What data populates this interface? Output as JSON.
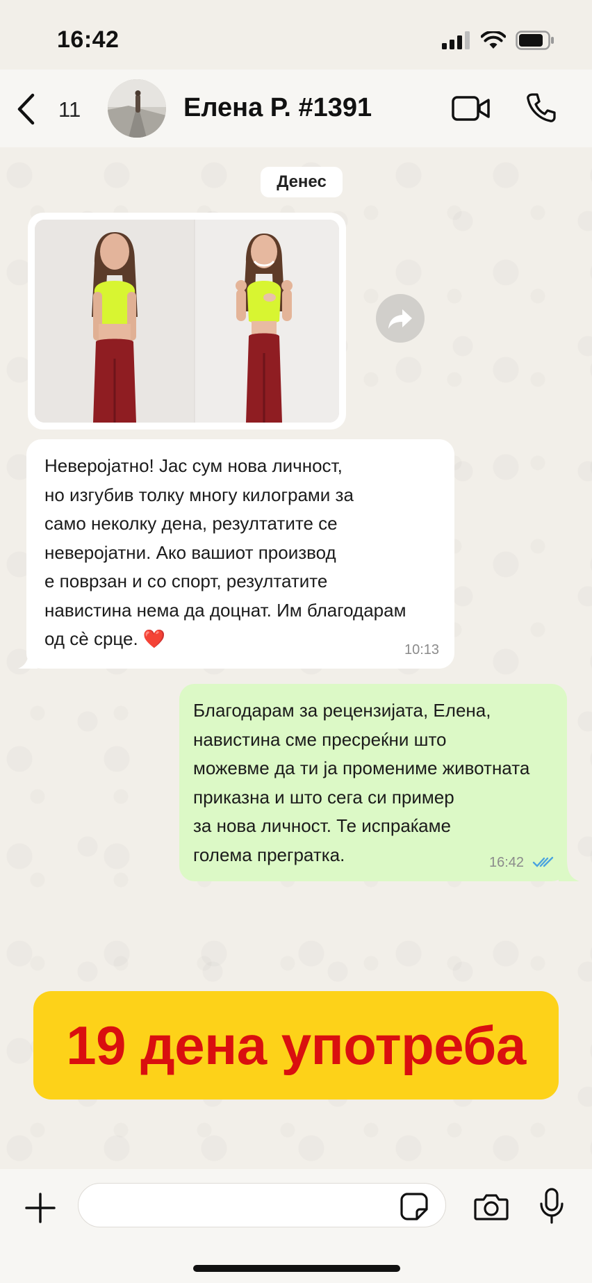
{
  "status_bar": {
    "time": "16:42"
  },
  "header": {
    "back_count": "11",
    "contact_name": "Елена Р. #1391"
  },
  "chat": {
    "date_label": "Денес",
    "incoming": {
      "text": "Неверојатно! Јас сум нова личност,\nно изгубив толку многу килограми за\nсамо неколку дена, резултатите се\nневеројатни. Ако вашиот производ\nе поврзан и со спорт, резултатите\nнавистина нема да доцнат. Им благодарам\nод сè срце. ❤️",
      "time": "10:13"
    },
    "outgoing": {
      "text": "Благодарам за рецензијата, Елена,\nнавистина сме пресреќни што\nможевме да ти ја промениме животната\nприказна и што сега си пример\nза нова личност. Те испраќаме\nголема прегратка.",
      "time": "16:42"
    }
  },
  "banner": {
    "text": "19 дена употреба"
  },
  "composer": {
    "placeholder": ""
  },
  "colors": {
    "incoming_bubble": "#ffffff",
    "outgoing_bubble": "#dcf9c6",
    "banner_bg": "#fdd219",
    "banner_text": "#d90f0f",
    "read_ticks": "#4aa3df"
  }
}
